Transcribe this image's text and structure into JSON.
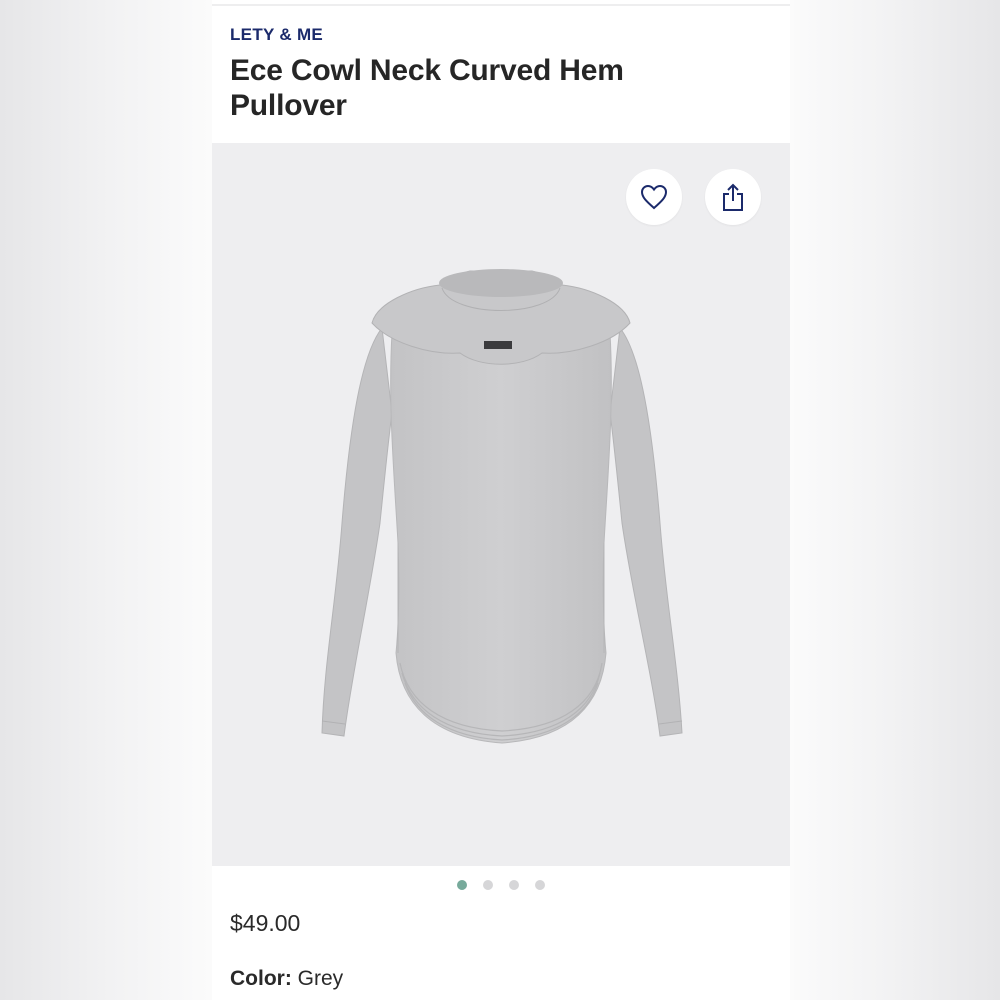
{
  "product": {
    "brand": "LETY & ME",
    "title": "Ece Cowl Neck Curved Hem Pullover",
    "price": "$49.00",
    "color_label": "Color:",
    "color_value": "Grey"
  },
  "gallery": {
    "image_count": 4,
    "active_index": 0,
    "actions": [
      {
        "name": "favorite",
        "icon": "heart-icon"
      },
      {
        "name": "share",
        "icon": "share-icon"
      }
    ]
  },
  "colors": {
    "brand_text": "#1b2a6b",
    "active_dot": "#77aa9b",
    "inactive_dot": "#d6d6d8",
    "sweater": "#c9c9cb"
  }
}
